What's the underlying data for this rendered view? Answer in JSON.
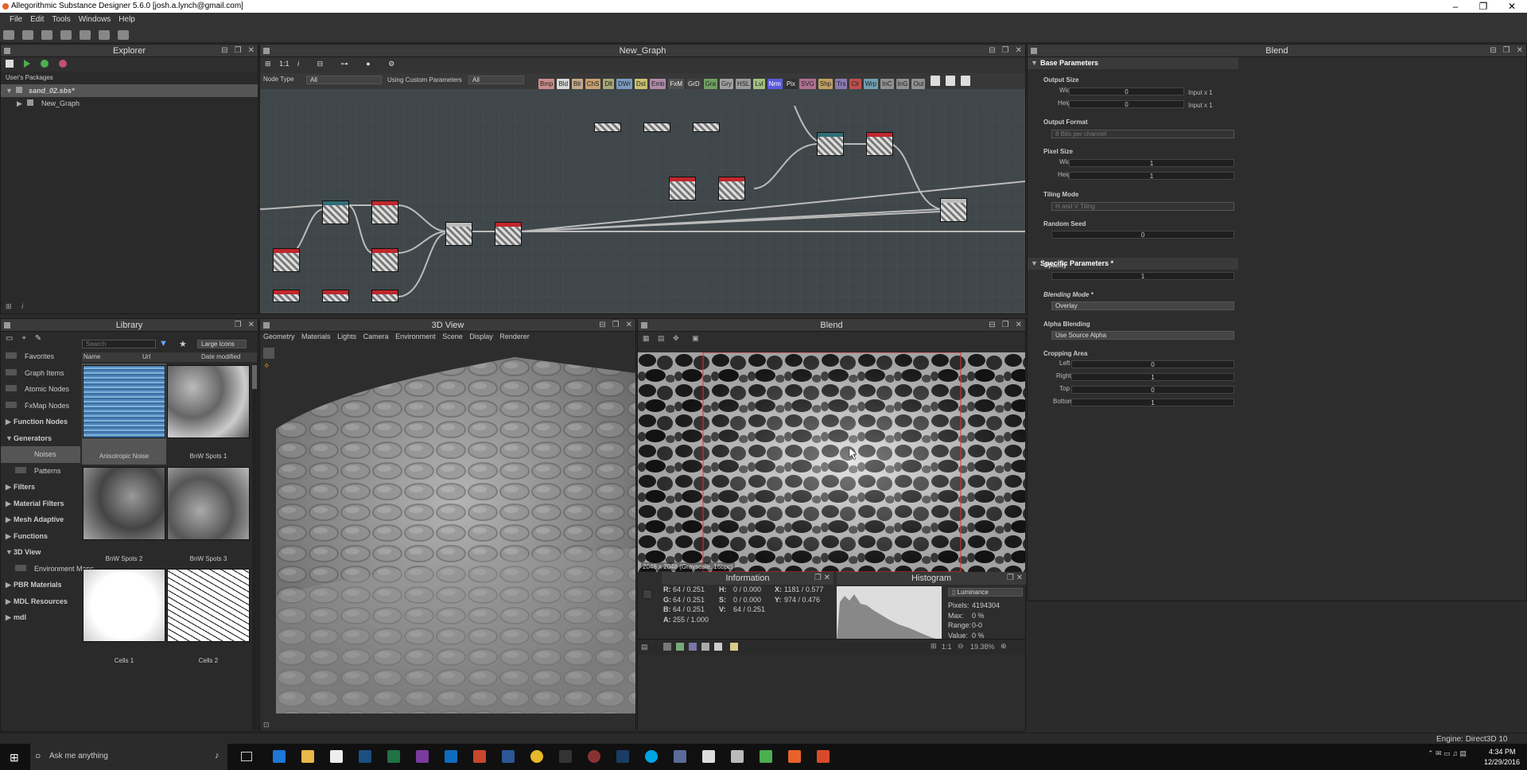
{
  "window": {
    "title": "Allegorithmic Substance Designer 5.6.0 [josh.a.lynch@gmail.com]",
    "minimize": "–",
    "maximize": "❐",
    "close": "✕"
  },
  "menu": [
    "File",
    "Edit",
    "Tools",
    "Windows",
    "Help"
  ],
  "explorer": {
    "title": "Explorer",
    "section": "User's Packages",
    "package": "sand_02.sbs*",
    "graph": "New_Graph",
    "bottom_label": "i"
  },
  "graph": {
    "title": "New_Graph",
    "zoom": "1:1",
    "node_type_label": "Node Type",
    "node_type_value": "All",
    "custom_params_label": "Using Custom Parameters",
    "custom_params_value": "All",
    "filters": [
      {
        "label": "Bmp",
        "color": "#c98a8a"
      },
      {
        "label": "Bld",
        "color": "#d8d8d8"
      },
      {
        "label": "Blr",
        "color": "#c4a88a"
      },
      {
        "label": "ChS",
        "color": "#c9a070"
      },
      {
        "label": "Dlt",
        "color": "#a8a878"
      },
      {
        "label": "DWr",
        "color": "#7a9abf"
      },
      {
        "label": "Dst",
        "color": "#c9c070"
      },
      {
        "label": "Emb",
        "color": "#b08aa8"
      },
      {
        "label": "FxM",
        "color": "#505050"
      },
      {
        "label": "GrD",
        "color": "#404040"
      },
      {
        "label": "Gra",
        "color": "#70a060"
      },
      {
        "label": "Gry",
        "color": "#a0a0a0"
      },
      {
        "label": "HSL",
        "color": "#9a9a9a"
      },
      {
        "label": "Lvl",
        "color": "#a0c080"
      },
      {
        "label": "Nrm",
        "color": "#5a5adf"
      },
      {
        "label": "Pix",
        "color": "#303030"
      },
      {
        "label": "SVG",
        "color": "#b07090"
      },
      {
        "label": "Shp",
        "color": "#c0a060"
      },
      {
        "label": "Trs",
        "color": "#8a7ab0"
      },
      {
        "label": "Clr",
        "color": "#c05050"
      },
      {
        "label": "Wrp",
        "color": "#70a0b0"
      },
      {
        "label": "InC",
        "color": "#909090"
      },
      {
        "label": "InG",
        "color": "#909090"
      },
      {
        "label": "Out",
        "color": "#909090"
      }
    ]
  },
  "library": {
    "title": "Library",
    "search_placeholder": "Search",
    "view_mode": "Large Icons",
    "columns": [
      "Name",
      "Url",
      "Date modified"
    ],
    "categories": [
      {
        "label": "Favorites",
        "bold": false,
        "arrow": ""
      },
      {
        "label": "Graph Items",
        "bold": false,
        "arrow": ""
      },
      {
        "label": "Atomic Nodes",
        "bold": false,
        "arrow": ""
      },
      {
        "label": "FxMap Nodes",
        "bold": false,
        "arrow": ""
      },
      {
        "label": "Function Nodes",
        "bold": true,
        "arrow": "▶"
      },
      {
        "label": "Generators",
        "bold": true,
        "arrow": "▼"
      },
      {
        "label": "Noises",
        "bold": false,
        "arrow": ""
      },
      {
        "label": "Patterns",
        "bold": false,
        "arrow": ""
      },
      {
        "label": "Filters",
        "bold": true,
        "arrow": "▶"
      },
      {
        "label": "Material Filters",
        "bold": true,
        "arrow": "▶"
      },
      {
        "label": "Mesh Adaptive",
        "bold": true,
        "arrow": "▶"
      },
      {
        "label": "Functions",
        "bold": true,
        "arrow": "▶"
      },
      {
        "label": "3D View",
        "bold": true,
        "arrow": "▼"
      },
      {
        "label": "Environment Maps",
        "bold": false,
        "arrow": ""
      },
      {
        "label": "PBR Materials",
        "bold": true,
        "arrow": "▶"
      },
      {
        "label": "MDL Resources",
        "bold": true,
        "arrow": "▶"
      },
      {
        "label": "mdl",
        "bold": true,
        "arrow": "▶"
      }
    ],
    "items": [
      "Anisotropic Noise",
      "BnW Spots 1",
      "BnW Spots 2",
      "BnW Spots 3",
      "Cells 1",
      "Cells 2"
    ]
  },
  "view3d": {
    "title": "3D View",
    "menus": [
      "Geometry",
      "Materials",
      "Lights",
      "Camera",
      "Environment",
      "Scene",
      "Display",
      "Renderer"
    ]
  },
  "blend2d": {
    "title": "Blend",
    "image_info": "2048 x 2048 (Grayscale, 16bpc)",
    "zoom": "19.38%",
    "ratio": "1:1"
  },
  "information": {
    "title": "Information",
    "rows": [
      {
        "c1": "R:",
        "v1": "64 / 0.251",
        "c2": "H:",
        "v2": "0 / 0.000",
        "c3": "X:",
        "v3": "1181 / 0.577"
      },
      {
        "c1": "G:",
        "v1": "64 / 0.251",
        "c2": "S:",
        "v2": "0 / 0.000",
        "c3": "Y:",
        "v3": "974 / 0.476"
      },
      {
        "c1": "B:",
        "v1": "64 / 0.251",
        "c2": "V:",
        "v2": "64 / 0.251",
        "c3": "",
        "v3": ""
      },
      {
        "c1": "A:",
        "v1": "255 / 1.000",
        "c2": "",
        "v2": "",
        "c3": "",
        "v3": ""
      }
    ]
  },
  "histogram": {
    "title": "Histogram",
    "channel": "Luminance",
    "stats": [
      {
        "label": "Pixels:",
        "value": "4194304"
      },
      {
        "label": "Max:",
        "value": "0 %"
      },
      {
        "label": "Range:",
        "value": "0-0"
      },
      {
        "label": "Value:",
        "value": "0 %"
      }
    ]
  },
  "properties": {
    "title": "Blend",
    "base_section": "Base Parameters",
    "output_size": "Output Size",
    "width_label": "Width",
    "height_label": "Height",
    "width_value": "0",
    "height_value": "0",
    "width_suffix": "Input x 1",
    "height_suffix": "Input x 1",
    "output_format": "Output Format",
    "output_format_value": "8 Bits per channel",
    "pixel_size": "Pixel Size",
    "pixel_width": "1",
    "pixel_height": "1",
    "tiling_mode": "Tiling Mode",
    "tiling_value": "H and V Tiling",
    "random_seed": "Random Seed",
    "random_seed_value": "0",
    "specific_section": "Specific Parameters *",
    "opacity": "Opacity",
    "opacity_value": "1",
    "blending_mode": "Blending Mode *",
    "blending_mode_value": "Overlay",
    "alpha_blending": "Alpha Blending",
    "alpha_blending_value": "Use Source Alpha",
    "cropping_area": "Cropping Area",
    "left_label": "Left",
    "left_value": "0",
    "right_label": "Right",
    "right_value": "1",
    "top_label": "Top",
    "top_value": "0",
    "bottom_label": "Bottom",
    "bottom_value": "1"
  },
  "status": {
    "engine": "Engine: Direct3D 10"
  },
  "taskbar": {
    "search_placeholder": "Ask me anything",
    "time": "4:34 PM",
    "date": "12/29/2016"
  }
}
